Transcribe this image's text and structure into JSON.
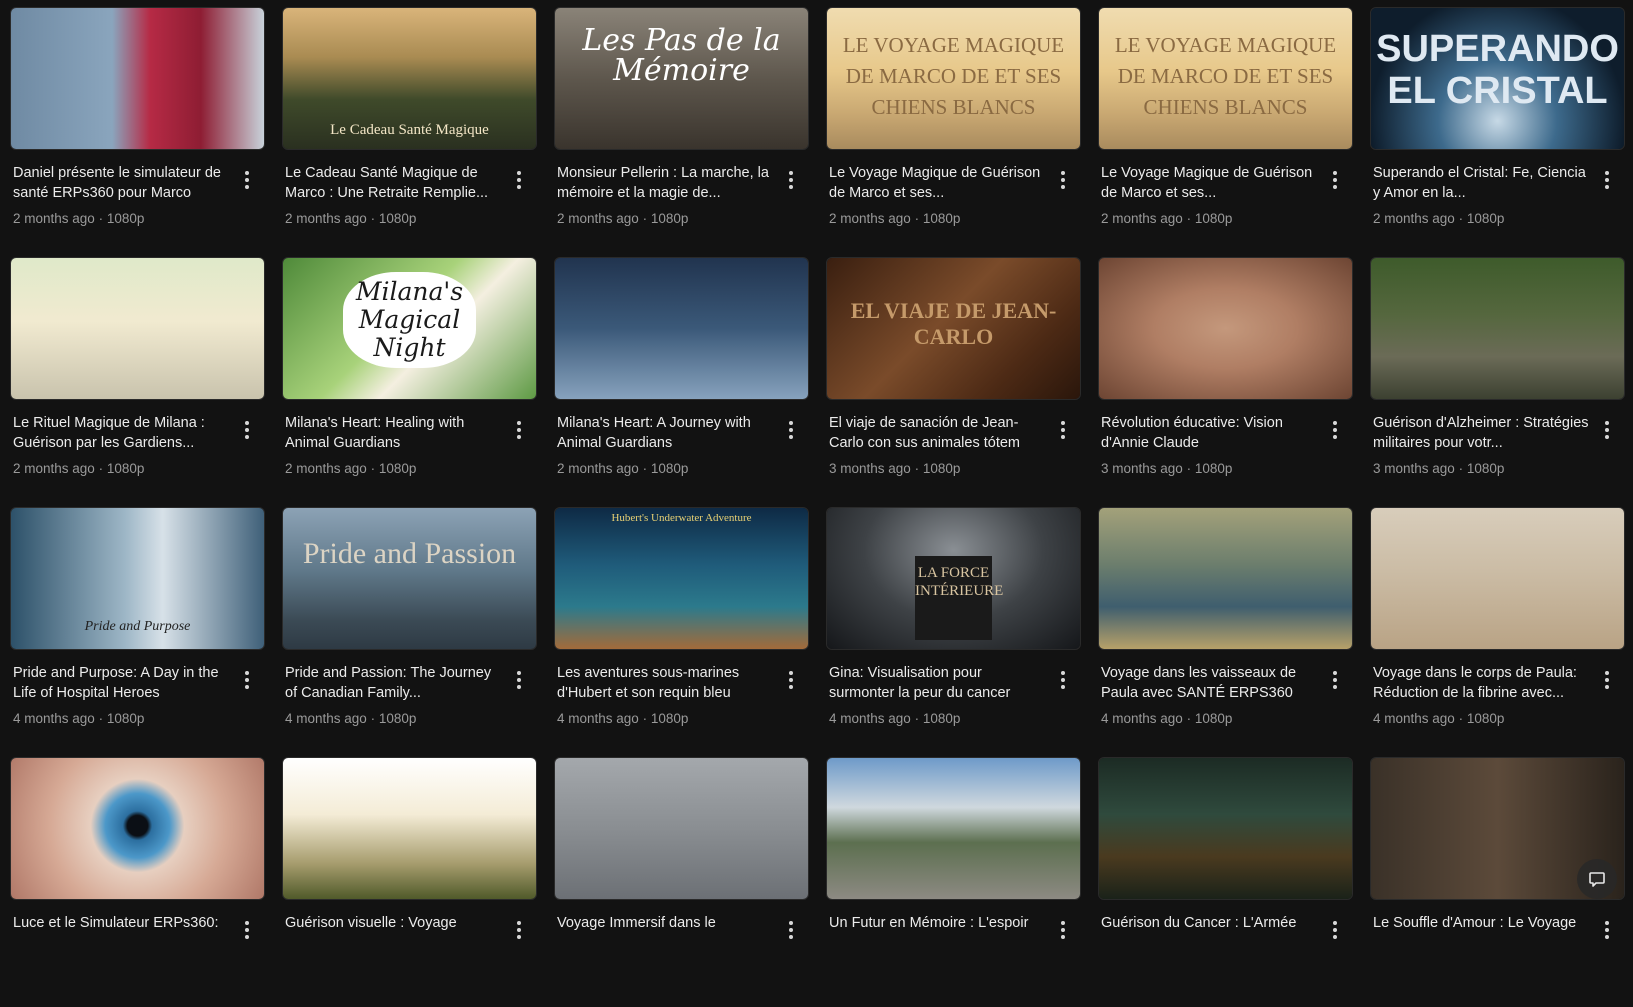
{
  "videos": [
    {
      "title": "Daniel présente le simulateur de santé ERPs360 pour Marco",
      "age": "2 months ago",
      "quality": "1080p",
      "thumb_text": ""
    },
    {
      "title": "Le Cadeau Santé Magique de Marco : Une Retraite Remplie...",
      "age": "2 months ago",
      "quality": "1080p",
      "thumb_text": "Le Cadeau Santé Magique"
    },
    {
      "title": "Monsieur Pellerin : La marche, la mémoire et la magie de...",
      "age": "2 months ago",
      "quality": "1080p",
      "thumb_text": "Les Pas de la Mémoire"
    },
    {
      "title": "Le Voyage Magique de Guérison de Marco et ses...",
      "age": "2 months ago",
      "quality": "1080p",
      "thumb_text": "LE VOYAGE MAGIQUE DE MARCO DE ET SES CHIENS BLANCS"
    },
    {
      "title": "Le Voyage Magique de Guérison de Marco et ses...",
      "age": "2 months ago",
      "quality": "1080p",
      "thumb_text": "LE VOYAGE MAGIQUE DE MARCO DE ET SES CHIENS BLANCS"
    },
    {
      "title": "Superando el Cristal: Fe, Ciencia y Amor en la...",
      "age": "2 months ago",
      "quality": "1080p",
      "thumb_text": "SUPERANDO EL CRISTAL"
    },
    {
      "title": "Le Rituel Magique de Milana : Guérison par les Gardiens...",
      "age": "2 months ago",
      "quality": "1080p",
      "thumb_text": ""
    },
    {
      "title": "Milana's Heart: Healing with Animal Guardians",
      "age": "2 months ago",
      "quality": "1080p",
      "thumb_text": "Milana's Magical Night"
    },
    {
      "title": "Milana's Heart: A Journey with Animal Guardians",
      "age": "2 months ago",
      "quality": "1080p",
      "thumb_text": ""
    },
    {
      "title": "El viaje de sanación de Jean-Carlo con sus animales tótem",
      "age": "3 months ago",
      "quality": "1080p",
      "thumb_text": "EL VIAJE DE JEAN-CARLO"
    },
    {
      "title": "Révolution éducative: Vision d'Annie Claude",
      "age": "3 months ago",
      "quality": "1080p",
      "thumb_text": ""
    },
    {
      "title": "Guérison d'Alzheimer : Stratégies militaires pour votr...",
      "age": "3 months ago",
      "quality": "1080p",
      "thumb_text": ""
    },
    {
      "title": "Pride and Purpose: A Day in the Life of Hospital Heroes",
      "age": "4 months ago",
      "quality": "1080p",
      "thumb_text": "Pride and Purpose"
    },
    {
      "title": "Pride and Passion: The Journey of Canadian Family...",
      "age": "4 months ago",
      "quality": "1080p",
      "thumb_text": "Pride and Passion"
    },
    {
      "title": "Les aventures sous-marines d'Hubert et son requin bleu",
      "age": "4 months ago",
      "quality": "1080p",
      "thumb_text": "Hubert's Underwater Adventure"
    },
    {
      "title": "Gina: Visualisation pour surmonter la peur du cancer",
      "age": "4 months ago",
      "quality": "1080p",
      "thumb_text": "LA FORCE INTÉRIEURE"
    },
    {
      "title": "Voyage dans les vaisseaux de Paula avec SANTÉ ERPS360",
      "age": "4 months ago",
      "quality": "1080p",
      "thumb_text": ""
    },
    {
      "title": "Voyage dans le corps de Paula: Réduction de la fibrine avec...",
      "age": "4 months ago",
      "quality": "1080p",
      "thumb_text": ""
    },
    {
      "title": "Luce et le Simulateur ERPs360:",
      "age": "",
      "quality": "",
      "thumb_text": ""
    },
    {
      "title": "Guérison visuelle : Voyage",
      "age": "",
      "quality": "",
      "thumb_text": ""
    },
    {
      "title": "Voyage Immersif dans le",
      "age": "",
      "quality": "",
      "thumb_text": ""
    },
    {
      "title": "Un Futur en Mémoire : L'espoir",
      "age": "",
      "quality": "",
      "thumb_text": ""
    },
    {
      "title": "Guérison du Cancer : L'Armée",
      "age": "",
      "quality": "",
      "thumb_text": ""
    },
    {
      "title": "Le Souffle d'Amour : Le Voyage",
      "age": "",
      "quality": "",
      "thumb_text": ""
    }
  ],
  "thumb_styles": [
    "linear-gradient(90deg,#6f8aa3 0%,#8aa5bd 40%,#b62a45 55%,#8e1d33 75%,#c8d2da 100%)",
    "linear-gradient(180deg,#d9b47a 0%,#a98b52 35%,#3f4a2a 65%,#2a3020 100%)",
    "linear-gradient(180deg,#8a8378 0%,#5e574d 50%,#3a342d 100%)",
    "linear-gradient(180deg,#f0dcb0 0%,#e7c88a 45%,#c9a872 75%,#a98b5e 100%)",
    "linear-gradient(180deg,#f0dcb0 0%,#e7c88a 45%,#c9a872 75%,#a98b5e 100%)",
    "radial-gradient(circle at 50% 80%,#c7d9e6 0%,#3d6a8c 35%,#0e1d2c 75%)",
    "linear-gradient(180deg,#dfe9c9 0%,#f1ead0 45%,#c9c3ad 100%)",
    "linear-gradient(135deg,#4f8a3a 0%,#a8d27a 45%,#f4efe0 60%,#5e9a44 100%)",
    "linear-gradient(180deg,#21344f 0%,#3b5979 50%,#87a2bd 100%)",
    "linear-gradient(135deg,#3a1f10 0%,#7a4b2a 45%,#4d2a15 75%,#2a160b 100%)",
    "radial-gradient(ellipse at 50% 50%,#c4987c 0%,#b07e64 40%,#6d4533 100%)",
    "linear-gradient(180deg,#3e5b2b 0%,#55673e 40%,#6b6b57 70%,#3c4131 100%)",
    "linear-gradient(90deg,#2d5169 0%,#9db6c6 45%,#d7e1e8 60%,#3f6079 100%)",
    "linear-gradient(180deg,#8ca2b5 0%,#5f7889 45%,#3b4a55 80%,#2e3a44 100%)",
    "linear-gradient(180deg,#0e2a45 0%,#1f5b7a 40%,#2c7a8c 70%,#a36b3a 100%)",
    "radial-gradient(ellipse at 50% 30%,#8a8f94 0%,#3e4246 50%,#15171a 100%)",
    "linear-gradient(180deg,#a3a17a 0%,#6c7e6d 40%,#3f5e6e 70%,#b7a169 100%)",
    "linear-gradient(180deg,#d8cdbb 0%,#cbbca5 45%,#b9a385 100%)",
    "radial-gradient(circle at 50% 48%,#0b0f15 0%,#0b0f15 7%,#2c6fa0 10%,#4c98c9 22%,#e7cfc0 32%,#d6a995 60%,#b07868 100%)",
    "linear-gradient(180deg,#ffffff 0%,#f4ecd6 40%,#a69c6d 75%,#505a2a 100%)",
    "linear-gradient(180deg,#a4a8ac 0%,#8a8e92 50%,#6c7075 100%)",
    "linear-gradient(180deg,#6e9ac9 0%,#cfd8de 35%,#5c6f4f 60%,#8d8a83 100%)",
    "linear-gradient(180deg,#1c2b24 0%,#2f4a3d 40%,#4a3a1f 70%,#1a2219 100%)",
    "linear-gradient(90deg,#3a3128 0%,#5c4a3a 50%,#2a231c 100%)"
  ],
  "ui": {
    "chat_label": ""
  }
}
